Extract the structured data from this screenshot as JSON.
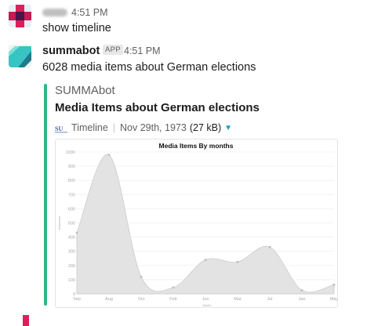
{
  "messages": [
    {
      "time": "4:51 PM",
      "text": "show timeline"
    },
    {
      "author": "summabot",
      "badge": "APP",
      "time": "4:51 PM",
      "text": "6028 media items about German elections",
      "attachment": {
        "author": "SUMMAbot",
        "title": "Media Items about German elections",
        "service": "Timeline",
        "date": "Nov 29th, 1973",
        "size": "(27 kB)",
        "accent_color": "#2eb886"
      }
    }
  ],
  "chart_data": {
    "type": "area",
    "title": "Media Items By months",
    "xlabel": "Month",
    "ylabel": "Instances",
    "categories": [
      "Sep",
      "Aug",
      "Oct",
      "Feb",
      "Jun",
      "Mar",
      "Jul",
      "Jan",
      "May"
    ],
    "values": [
      430,
      980,
      120,
      45,
      240,
      225,
      330,
      25,
      65
    ],
    "ylim": [
      0,
      1000
    ],
    "yticks": [
      0,
      100,
      200,
      300,
      400,
      500,
      600,
      700,
      800,
      900,
      1000
    ],
    "grid": true,
    "legend": "none",
    "fill_color": "#e3e3e3",
    "line_color": "#d2d2d2"
  }
}
